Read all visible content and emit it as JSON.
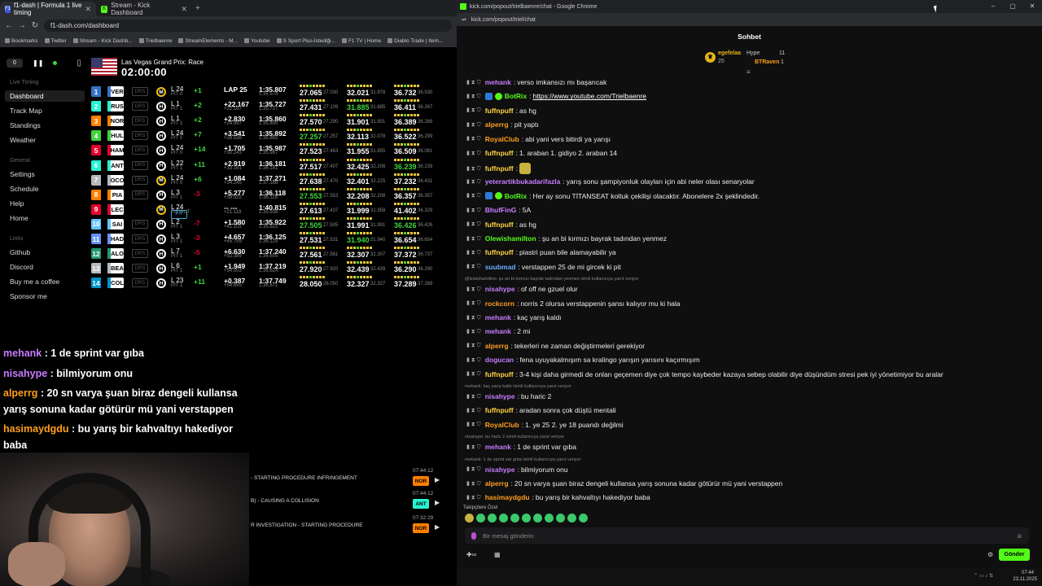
{
  "left_browser": {
    "tabs": [
      {
        "label": "f1-dash | Formula 1 live timing",
        "fav": "F1",
        "fav_color": "#3a5bd9"
      },
      {
        "label": "Stream - Kick Dashboard",
        "fav": "K",
        "fav_color": "#53fc18"
      }
    ],
    "url": "f1-dash.com/dashboard",
    "bookmarks": [
      "Bookmarks",
      "Twitter",
      "Stream - Kick Dashb...",
      "Trielbaenre",
      "StreamElements - M...",
      "Youtube",
      "S Sport Plus-İstediği...",
      "F1 TV | Home",
      "Diablo Trade | Item..."
    ]
  },
  "dash": {
    "laps_counter": "0",
    "nav_live_timing_header": "Live Timing",
    "nav_live": [
      "Dashboard",
      "Track Map",
      "Standings",
      "Weather"
    ],
    "nav_general_header": "General",
    "nav_general": [
      "Settings",
      "Schedule",
      "Help",
      "Home"
    ],
    "nav_links_header": "Links",
    "nav_links": [
      "Github",
      "Discord",
      "Buy me a coffee",
      "Sponsor me"
    ],
    "race_name": "Las Vegas Grand Prix: Race",
    "race_clock": "02:00:00",
    "rows": [
      {
        "pos": "1",
        "code": "VER",
        "color": "#3671c6",
        "drs": "DRS",
        "tyre": "M",
        "tyre_color": "#f0c419",
        "lap": "L 24",
        "pit": "PIT 0",
        "gain": "+1",
        "gap": "LAP 25",
        "int": "",
        "best": "1:35.807",
        "last": "1:35.574",
        "s1": "27.065",
        "s1s": "27.030",
        "s2": "32.021",
        "s2s": "31.978",
        "s3": "36.732",
        "s3s": "36.530",
        "s1c": "#fff",
        "s2c": "#fff",
        "s3c": "#fff",
        "gainc": "#3fd43f"
      },
      {
        "pos": "2",
        "code": "RUS",
        "color": "#27f4d2",
        "drs": "DRS",
        "tyre": "H",
        "tyre_color": "#fff",
        "lap": "L 1",
        "pit": "PIT 1",
        "gain": "+2",
        "gap": "+22.167",
        "int": "+22.167",
        "best": "1:35.727",
        "last": "1:35.727",
        "s1": "27.431",
        "s1s": "27.109",
        "s2": "31.885",
        "s2s": "31.885",
        "s3": "36.411",
        "s3s": "36.267",
        "s1c": "#fff",
        "s2c": "#3fd43f",
        "s3c": "#fff",
        "gainc": "#3fd43f"
      },
      {
        "pos": "3",
        "code": "NOR",
        "color": "#ff8000",
        "drs": "DRS",
        "tyre": "H",
        "tyre_color": "#fff",
        "lap": "L 1",
        "pit": "PIT 1",
        "gain": "+2",
        "gap": "+2.830",
        "int": "+24.997",
        "best": "1:35.860",
        "last": "1:35.800",
        "s1": "27.570",
        "s1s": "27.290",
        "s2": "31.901",
        "s2s": "31.901",
        "s3": "36.389",
        "s3s": "36.288",
        "s1c": "#fff",
        "s2c": "#fff",
        "s3c": "#fff",
        "gainc": "#3fd43f"
      },
      {
        "pos": "4",
        "code": "HUL",
        "color": "#3fd43f",
        "drs": "DRS",
        "tyre": "H",
        "tyre_color": "#fff",
        "lap": "L 24",
        "pit": "PIT 0",
        "gain": "+7",
        "gap": "+3.541",
        "int": "+28.538",
        "best": "1:35.892",
        "last": "1:35.892",
        "s1": "27.257",
        "s1s": "27.257",
        "s2": "32.113",
        "s2s": "32.078",
        "s3": "36.522",
        "s3s": "36.299",
        "s1c": "#3fd43f",
        "s2c": "#fff",
        "s3c": "#fff",
        "gainc": "#3fd43f"
      },
      {
        "pos": "5",
        "code": "HAM",
        "color": "#e8002d",
        "drs": "DRS",
        "tyre": "H",
        "tyre_color": "#fff",
        "lap": "L 24",
        "pit": "PIT 0",
        "gain": "+14",
        "gap": "+1.705",
        "int": "+30.243",
        "best": "1:35.987",
        "last": "1:35.987",
        "s1": "27.523",
        "s1s": "27.463",
        "s2": "31.955",
        "s2s": "31.955",
        "s3": "36.509",
        "s3s": "36.081",
        "s1c": "#fff",
        "s2c": "#fff",
        "s3c": "#fff",
        "gainc": "#3fd43f"
      },
      {
        "pos": "6",
        "code": "ANT",
        "color": "#27f4d2",
        "drs": "DRS",
        "tyre": "H",
        "tyre_color": "#fff",
        "lap": "L 22",
        "pit": "PIT 1",
        "gain": "+11",
        "gap": "+2.919",
        "int": "+33.161",
        "best": "1:36.181",
        "last": "1:36.181",
        "s1": "27.517",
        "s1s": "27.407",
        "s2": "32.425",
        "s2s": "32.206",
        "s3": "36.239",
        "s3s": "36.239",
        "s1c": "#fff",
        "s2c": "#fff",
        "s3c": "#3fd43f",
        "gainc": "#3fd43f"
      },
      {
        "pos": "7",
        "code": "OCO",
        "color": "#b6babd",
        "drs": "DRS",
        "tyre": "M",
        "tyre_color": "#f0c419",
        "lap": "L 24",
        "pit": "PIT 0",
        "gain": "+6",
        "gap": "+1.084",
        "int": "+34.245",
        "best": "1:37.271",
        "last": "1:37.188",
        "s1": "27.638",
        "s1s": "27.470",
        "s2": "32.401",
        "s2s": "32.225",
        "s3": "37.232",
        "s3s": "36.431",
        "s1c": "#fff",
        "s2c": "#fff",
        "s3c": "#fff",
        "gainc": "#3fd43f"
      },
      {
        "pos": "8",
        "code": "PIA",
        "color": "#ff8000",
        "drs": "DRS",
        "tyre": "H",
        "tyre_color": "#fff",
        "lap": "L 3",
        "pit": "PIT 1",
        "gain": "-3",
        "gap": "+5.277",
        "int": "+39.522",
        "best": "1:36.118",
        "last": "1:36.118",
        "s1": "27.553",
        "s1s": "27.553",
        "s2": "32.208",
        "s2s": "32.208",
        "s3": "36.357",
        "s3s": "36.357",
        "s1c": "#3fd43f",
        "s2c": "#fff",
        "s3c": "#fff",
        "gainc": "#e8002d"
      },
      {
        "pos": "9",
        "code": "LEC",
        "color": "#e8002d",
        "drs": "PIT",
        "tyre": "M",
        "tyre_color": "#f0c419",
        "lap": "L 24",
        "pit": "PIT OUT",
        "gain": "",
        "gap": "-- ---",
        "int": "+21.118",
        "best": "1:40.815",
        "last": "1:35.938",
        "s1": "27.613",
        "s1s": "27.437",
        "s2": "31.999",
        "s2s": "31.959",
        "s3": "41.402",
        "s3s": "36.329",
        "s1c": "#fff",
        "s2c": "#fff",
        "s3c": "#fff",
        "gainc": "#fff"
      },
      {
        "pos": "10",
        "code": "SAI",
        "color": "#64c4ff",
        "drs": "DRS",
        "tyre": "H",
        "tyre_color": "#fff",
        "lap": "L 2",
        "pit": "PIT 1",
        "gain": "-7",
        "gap": "+1.580",
        "int": "+41.102",
        "best": "1:35.922",
        "last": "1:35.922",
        "s1": "27.505",
        "s1s": "27.505",
        "s2": "31.991",
        "s2s": "31.991",
        "s3": "36.426",
        "s3s": "36.426",
        "s1c": "#3fd43f",
        "s2c": "#fff",
        "s3c": "#3fd43f",
        "gainc": "#e8002d"
      },
      {
        "pos": "11",
        "code": "HAD",
        "color": "#6692ff",
        "drs": "DRS",
        "tyre": "H",
        "tyre_color": "#fff",
        "lap": "L 3",
        "pit": "PIT 1",
        "gain": "-3",
        "gap": "+4.657",
        "int": "+45.759",
        "best": "1:36.125",
        "last": "1:36.125",
        "s1": "27.531",
        "s1s": "27.531",
        "s2": "31.940",
        "s2s": "31.940",
        "s3": "36.654",
        "s3s": "36.654",
        "s1c": "#fff",
        "s2c": "#3fd43f",
        "s3c": "#fff",
        "gainc": "#e8002d"
      },
      {
        "pos": "12",
        "code": "ALO",
        "color": "#229971",
        "drs": "DRS",
        "tyre": "H",
        "tyre_color": "#fff",
        "lap": "L 7",
        "pit": "PIT 1",
        "gain": "-5",
        "gap": "+6.630",
        "int": "+52.389",
        "best": "1:37.240",
        "last": "1:36.605",
        "s1": "27.561",
        "s1s": "27.561",
        "s2": "32.307",
        "s2s": "32.307",
        "s3": "37.372",
        "s3s": "36.737",
        "s1c": "#fff",
        "s2c": "#fff",
        "s3c": "#fff",
        "gainc": "#e8002d"
      },
      {
        "pos": "13",
        "code": "BEA",
        "color": "#b6babd",
        "drs": "DRS",
        "tyre": "H",
        "tyre_color": "#fff",
        "lap": "L 6",
        "pit": "PIT 1",
        "gain": "+1",
        "gap": "+1.949",
        "int": "+54.003",
        "best": "1:37.219",
        "last": "1:36.624",
        "s1": "27.920",
        "s1s": "27.920",
        "s2": "32.439",
        "s2s": "32.439",
        "s3": "36.290",
        "s3s": "36.290",
        "s1c": "#fff",
        "s2c": "#fff",
        "s3c": "#fff",
        "gainc": "#3fd43f"
      },
      {
        "pos": "14",
        "code": "COL",
        "color": "#0093cc",
        "drs": "DRS",
        "tyre": "H",
        "tyre_color": "#fff",
        "lap": "L 23",
        "pit": "PIT 1",
        "gain": "+11",
        "gap": "+0.387",
        "int": "+54.655",
        "best": "1:37.749",
        "last": "1:36.871",
        "s1": "28.050",
        "s1s": "28.050",
        "s2": "32.327",
        "s2s": "32.327",
        "s3": "37.289",
        "s3s": "37.289",
        "s1c": "#fff",
        "s2c": "#fff",
        "s3c": "#fff",
        "gainc": "#3fd43f"
      }
    ]
  },
  "overlay_chat": [
    {
      "user": "mehank",
      "user_color": "#c77dff",
      "text": " : 1 de sprint var gıba"
    },
    {
      "user": "nisahype",
      "user_color": "#c77dff",
      "text": " : bilmiyorum onu"
    },
    {
      "user": "alperrg",
      "user_color": "#ff9f1c",
      "text": " : 20 sn varya şuan biraz dengeli kullansa"
    },
    {
      "user": "",
      "user_color": "#fff",
      "text": "yarış sonuna kadar götürür mü yani verstappen"
    },
    {
      "user": "hasimaydgdu",
      "user_color": "#ff9f1c",
      "text": " : bu yarış bir kahvaltıyı hakediyor"
    },
    {
      "user": "",
      "user_color": "#fff",
      "text": "baba"
    }
  ],
  "race_control": {
    "messages": [
      "- STARTING PROCEDURE INFRINGEMENT",
      "B) - CAUSING A COLLISION",
      "R INVESTIGATION - STARTING PROCEDURE"
    ],
    "times": [
      "07:44:12",
      "07:44:12",
      "07:32:29"
    ],
    "tags": [
      {
        "code": "NOR",
        "color": "#ff8000"
      },
      {
        "code": "ANT",
        "color": "#27f4d2"
      },
      {
        "code": "NOR",
        "color": "#ff8000"
      }
    ]
  },
  "right_window": {
    "title": "kick.com/popout/trielbaenre/chat - Google Chrome",
    "url": "kick.com/popout/triel/chat",
    "chat_title": "Sohbet",
    "leaderboard": {
      "top_user": "egefelaa",
      "top_value": "25",
      "hype_label": "Hype",
      "hype_value": "11",
      "second_user": "BTRaven",
      "second_value": "1"
    },
    "messages": [
      {
        "user": "mehank",
        "color": "#c77dff",
        "text": "verso imkansızı mı başarıcak"
      },
      {
        "user": "BotRix",
        "color": "#53fc18",
        "text": "https://www.youtube.com/Trielbaenre",
        "link": true,
        "bot": true
      },
      {
        "user": "fuffnpuff",
        "color": "#ffd23f",
        "text": "as hg"
      },
      {
        "user": "alperrg",
        "color": "#ff9f1c",
        "text": "pit yaptı"
      },
      {
        "user": "RoyalClub",
        "color": "#ff9f1c",
        "text": "abi yani vers bitirdi ya yarışı"
      },
      {
        "user": "fuffnpuff",
        "color": "#ffd23f",
        "text": "1. araban 1. gidiyo 2. araban 14"
      },
      {
        "user": "fuffnpuff",
        "color": "#ffd23f",
        "text": "",
        "emote": true
      },
      {
        "user": "yeterartikbukadarifazla",
        "color": "#c77dff",
        "text": "yarış sonu şampiyonluk olayları için abi neler olası senaryolar"
      },
      {
        "user": "BotRix",
        "color": "#53fc18",
        "text": "Her ay sonu TİTANSEAT koltuk çekilişi olacaktır. Abonelere 2x şeklindedir.",
        "bot": true
      },
      {
        "user": "BhufFinG",
        "color": "#c77dff",
        "text": "5A"
      },
      {
        "user": "fuffnpuff",
        "color": "#ffd23f",
        "text": "as hg"
      },
      {
        "user": "Olewishamilton",
        "color": "#53fc18",
        "text": "şu an bi kırmızı bayrak tadından yenmez"
      },
      {
        "user": "fuffnpuff",
        "color": "#ffd23f",
        "text": "piastri puan bile alamayabilir ya"
      },
      {
        "user": "suubmad",
        "color": "#6ab0ff",
        "text": "verstappen 25 de mi gircek ki pit"
      },
      {
        "user": "nisahype",
        "color": "#c77dff",
        "text": "of off ne gzuel olur",
        "reply": "@lewishamilton: şu an bi kırmızı bayrak tadından yenmez isimli kullanıcıya yanıt veriyor"
      },
      {
        "user": "rockcorn",
        "color": "#ff9f1c",
        "text": "norris 2 olursa verstappenin şansı kalıyor mu ki hala"
      },
      {
        "user": "mehank",
        "color": "#c77dff",
        "text": "kaç yarış kaldı"
      },
      {
        "user": "mehank",
        "color": "#c77dff",
        "text": "2 mi"
      },
      {
        "user": "alperrg",
        "color": "#ff9f1c",
        "text": "tekerleri ne zaman değiştirmeleri gerekiyor"
      },
      {
        "user": "dogucan",
        "color": "#c77dff",
        "text": "fena uyuyakalmışım sa kralingo yarışın yarısını kaçırmışım"
      },
      {
        "user": "fuffnpuff",
        "color": "#ffd23f",
        "text": "3-4 kişi daha girmedi de onları geçemen diye çok tempo kaybeder kazaya sebep olabilir diye düşündüm stresi pek iyi yönetimiyor bu aralar"
      },
      {
        "user": "nisahype",
        "color": "#c77dff",
        "text": "bu haric 2",
        "reply": "mehank: kaç yarış kaldı isimli kullanıcıya yanıt veriyor"
      },
      {
        "user": "fuffnpuff",
        "color": "#ffd23f",
        "text": "aradan sonra çok düştü mentali"
      },
      {
        "user": "RoyalClub",
        "color": "#ff9f1c",
        "text": "1. ye 25 2. ye 18 puandı değilmi"
      },
      {
        "user": "mehank",
        "color": "#c77dff",
        "text": "1 de sprint var gıba",
        "reply": "nisahype: bu haric 2 isimli kullanıcıya yanıt veriyor"
      },
      {
        "user": "nisahype",
        "color": "#c77dff",
        "text": "bilmiyorum onu",
        "reply": "mehank: 1 de sprint var gıba isimli kullanıcıya yanıt veriyor"
      },
      {
        "user": "alperrg",
        "color": "#ff9f1c",
        "text": "20 sn varya şuan biraz dengeli kullansa yarış sonuna kadar götürür mü yani verstappen"
      },
      {
        "user": "hasimaydgdu",
        "color": "#ff9f1c",
        "text": "bu yarış bir kahvaltıyı hakediyor baba"
      }
    ],
    "subscribers_label": "Takipçilere Özel",
    "input_placeholder": "Bir mesaj gönderin",
    "send_label": "Gönder",
    "clock_time": "07:44",
    "clock_date": "23.11.2025"
  }
}
